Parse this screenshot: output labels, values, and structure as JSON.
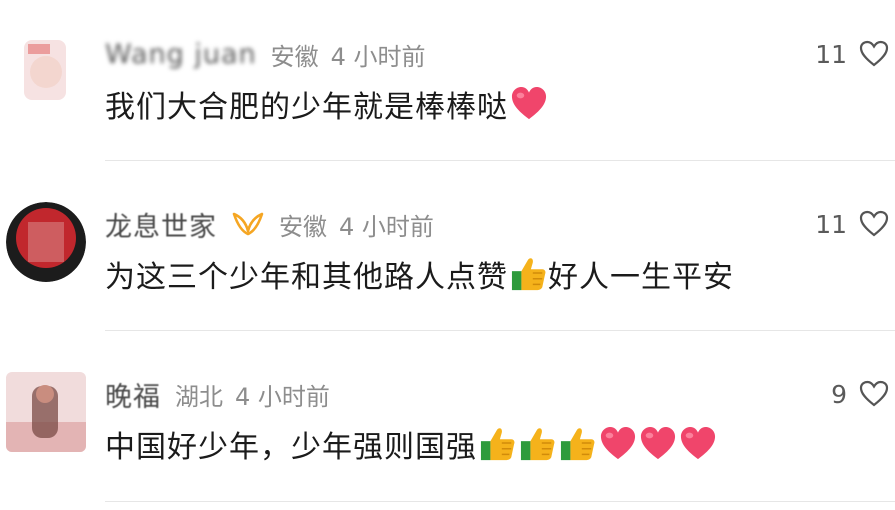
{
  "comments": [
    {
      "user": "Wang juan",
      "location": "安徽",
      "time": "4 小时前",
      "text": "我们大合肥的少年就是棒棒哒",
      "emojis": [
        "heart"
      ],
      "likes": "11"
    },
    {
      "user": "龙息世家",
      "location": "安徽",
      "time": "4 小时前",
      "text": "为这三个少年和其他路人点赞",
      "emojis": [
        "thumbs-up"
      ],
      "text_after": "好人一生平安",
      "likes": "11"
    },
    {
      "user": "晚福",
      "location": "湖北",
      "time": "4 小时前",
      "text": "中国好少年，少年强则国强",
      "emojis": [
        "thumbs-up",
        "thumbs-up",
        "thumbs-up",
        "heart",
        "heart",
        "heart"
      ],
      "likes": "9"
    }
  ],
  "colors": {
    "heart": "#f0456b",
    "thumb": "#f5b21b",
    "cuff": "#2e9b3c",
    "badge": "#f5a623"
  }
}
